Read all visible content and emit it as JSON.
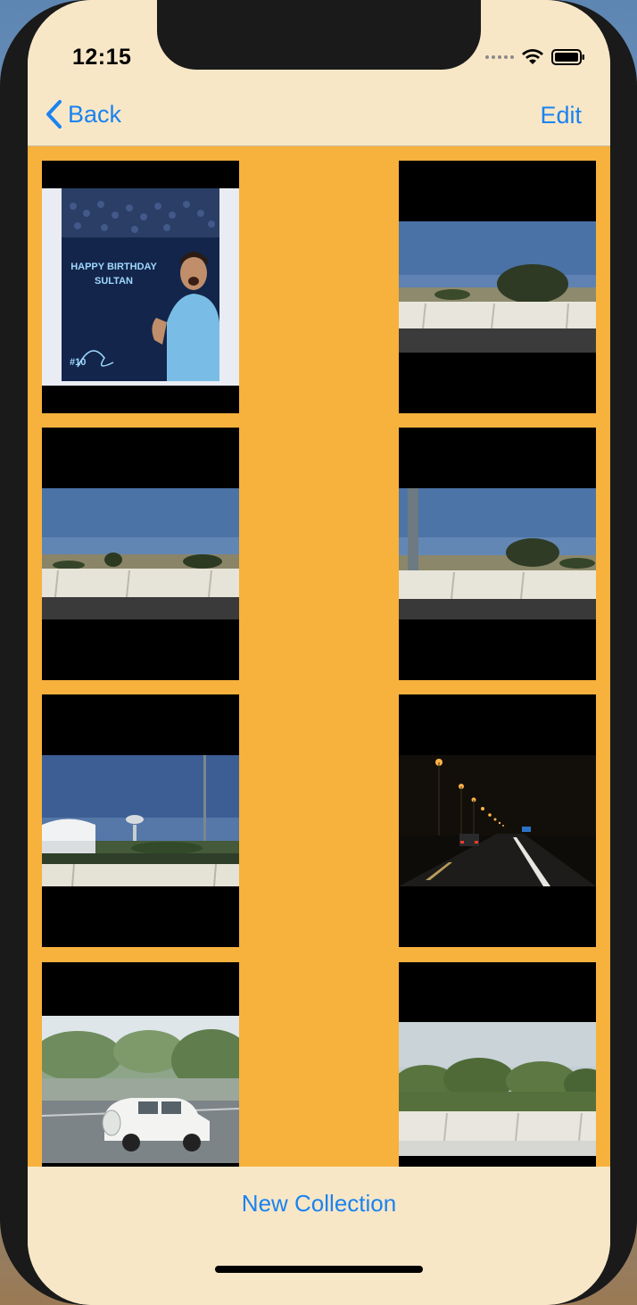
{
  "status_bar": {
    "time": "12:15"
  },
  "nav": {
    "back_label": "Back",
    "edit_label": "Edit"
  },
  "photos": [
    {
      "name": "birthday-poster-photo",
      "headline": "HAPPY BIRTHDAY",
      "subline": "SULTAN",
      "number": "#10"
    },
    {
      "name": "highway-daylight-photo-1"
    },
    {
      "name": "highway-daylight-photo-2"
    },
    {
      "name": "highway-lamppost-photo"
    },
    {
      "name": "stadium-water-tower-photo"
    },
    {
      "name": "night-highway-photo"
    },
    {
      "name": "white-suv-photo"
    },
    {
      "name": "roadside-trees-photo"
    }
  ],
  "bottom": {
    "new_collection_label": "New Collection"
  },
  "colors": {
    "accent": "#1a83f0",
    "grid_background": "#f7b13d",
    "bar_background": "#f8e7c7"
  }
}
